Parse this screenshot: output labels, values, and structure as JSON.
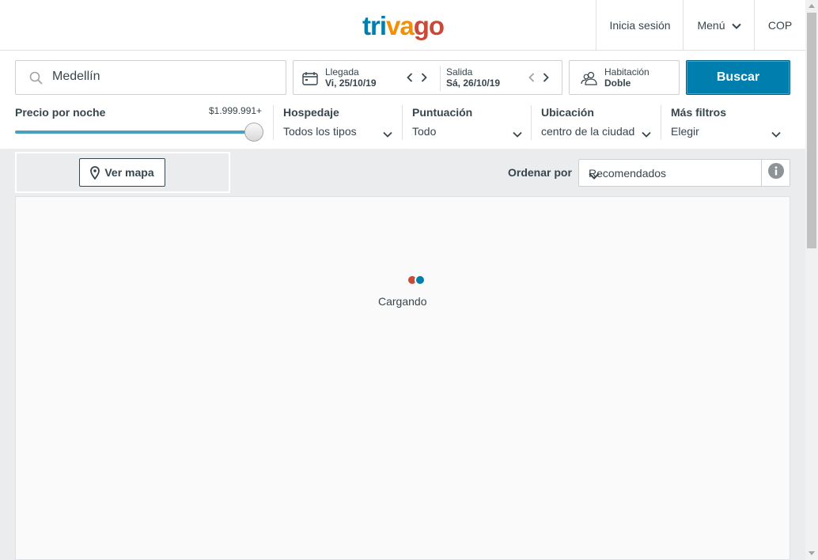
{
  "header": {
    "logo": {
      "part1": "tri",
      "part2": "va",
      "part3": "go"
    },
    "login_label": "Inicia sesión",
    "menu_label": "Menú",
    "currency_label": "COP"
  },
  "search": {
    "destination_value": "Medellín",
    "checkin": {
      "label": "Llegada",
      "value": "Vi, 25/10/19"
    },
    "checkout": {
      "label": "Salida",
      "value": "Sá, 26/10/19"
    },
    "room": {
      "label": "Habitación",
      "value": "Doble"
    },
    "search_button": "Buscar"
  },
  "filters": {
    "price": {
      "label": "Precio por noche",
      "max_label": "$1.999.991+",
      "slider_level": 1.0
    },
    "lodging": {
      "label": "Hospedaje",
      "value": "Todos los tipos"
    },
    "rating": {
      "label": "Puntuación",
      "value": "Todo"
    },
    "location": {
      "label": "Ubicación",
      "value": "centro de la ciudad"
    },
    "more": {
      "label": "Más filtros",
      "value": "Elegir"
    }
  },
  "toolbar": {
    "map_button": "Ver mapa",
    "sort_label": "Ordenar por",
    "sort_value": "Recomendados"
  },
  "results": {
    "loading_text": "Cargando"
  },
  "colors": {
    "brand_blue": "#007faf",
    "brand_orange": "#f48f00",
    "brand_red": "#c94a38"
  }
}
